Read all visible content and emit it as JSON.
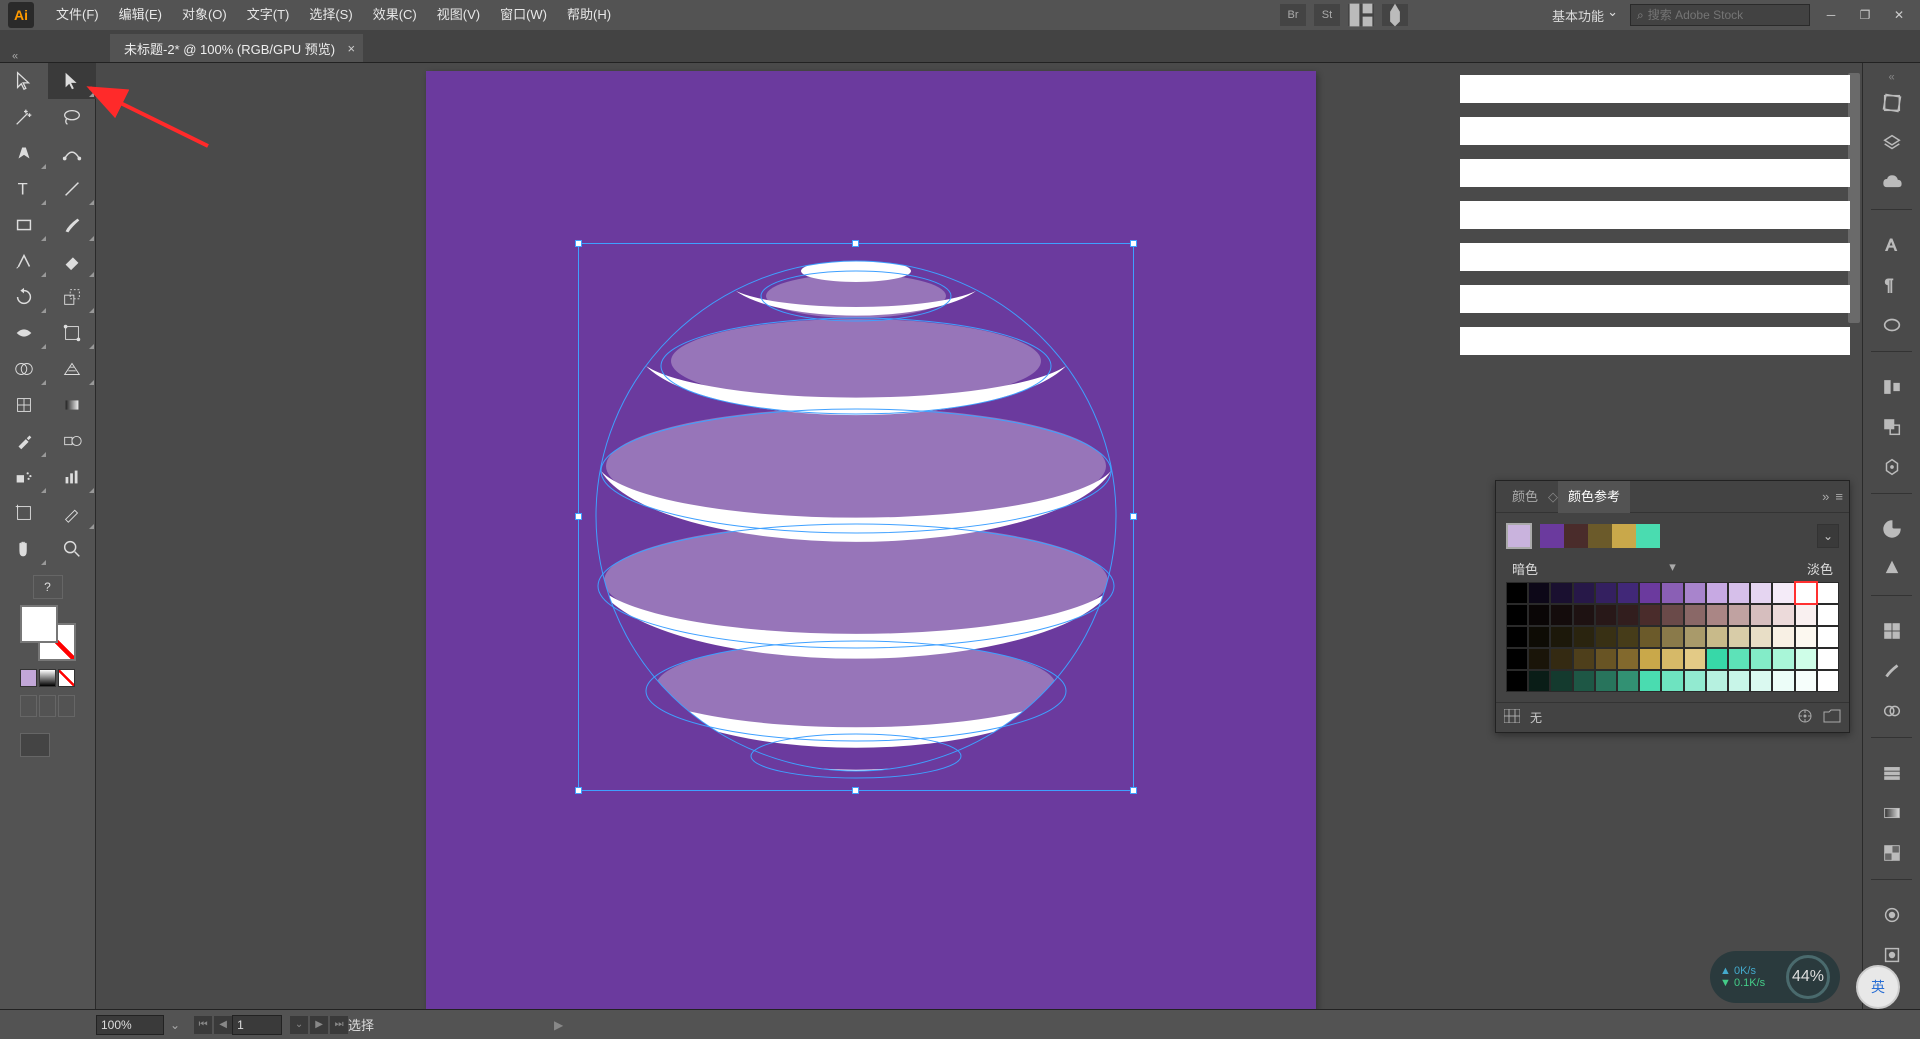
{
  "app_logo": "Ai",
  "menubar": [
    "文件(F)",
    "编辑(E)",
    "对象(O)",
    "文字(T)",
    "选择(S)",
    "效果(C)",
    "视图(V)",
    "窗口(W)",
    "帮助(H)"
  ],
  "menubar_right": {
    "br": "Br",
    "st": "St",
    "workspace": "基本功能",
    "search_placeholder": "搜索 Adobe Stock"
  },
  "doctab": {
    "title": "未标题-2* @ 100% (RGB/GPU 预览)",
    "close": "×"
  },
  "canvas": {
    "bg": "#6b3a9e"
  },
  "color_guide": {
    "tab1": "颜色",
    "tab2": "颜色参考",
    "dark_label": "暗色",
    "light_label": "淡色",
    "none_label": "无",
    "main_swatch": "#c9b3dd",
    "harmony": [
      "#6b3a9e",
      "#4a2c2b",
      "#6b5a2a",
      "#c9a84a",
      "#4adcb0"
    ],
    "shades": [
      [
        "#000000",
        "#0d0818",
        "#1a1030",
        "#271848",
        "#342060",
        "#412878",
        "#6b3a9e",
        "#8a5fb5",
        "#a884cc",
        "#c7a9e3",
        "#d6bfea",
        "#e5d5f1",
        "#f4ebf8",
        "#ffffff",
        "#ffffff"
      ],
      [
        "#000000",
        "#0a0606",
        "#140c0c",
        "#1e1212",
        "#281818",
        "#321e1e",
        "#4a2c2b",
        "#6a4a49",
        "#8a6867",
        "#aa8685",
        "#c0a2a1",
        "#d6bebe",
        "#ecdada",
        "#f9f0f0",
        "#ffffff"
      ],
      [
        "#000000",
        "#0e0c05",
        "#1c180a",
        "#2a240f",
        "#383014",
        "#463c19",
        "#6b5a2a",
        "#8a7a4a",
        "#a99a6a",
        "#c8ba8a",
        "#d8cca8",
        "#e8dec6",
        "#f8f0e4",
        "#fcf8f0",
        "#ffffff"
      ],
      [
        "#000000",
        "#1a1509",
        "#342a12",
        "#4e3f1b",
        "#685424",
        "#82692d",
        "#c9a84a",
        "#d6b968",
        "#e3ca86",
        "#37d8a8",
        "#5de2b8",
        "#83ecc8",
        "#a9f6d8",
        "#cffee8",
        "#ffffff"
      ],
      [
        "#000000",
        "#0a1d17",
        "#143a2e",
        "#1e5745",
        "#28745c",
        "#329173",
        "#4adcb0",
        "#6ee3c0",
        "#92ead0",
        "#b6f1e0",
        "#c8f5e8",
        "#daf9f0",
        "#ecfdf8",
        "#f6fefb",
        "#ffffff"
      ]
    ]
  },
  "statusbar": {
    "zoom": "100%",
    "art": "1",
    "sel": "选择"
  },
  "net": {
    "up": "0K/s",
    "down": "0.1K/s",
    "pct": "44%"
  },
  "ime": "英"
}
